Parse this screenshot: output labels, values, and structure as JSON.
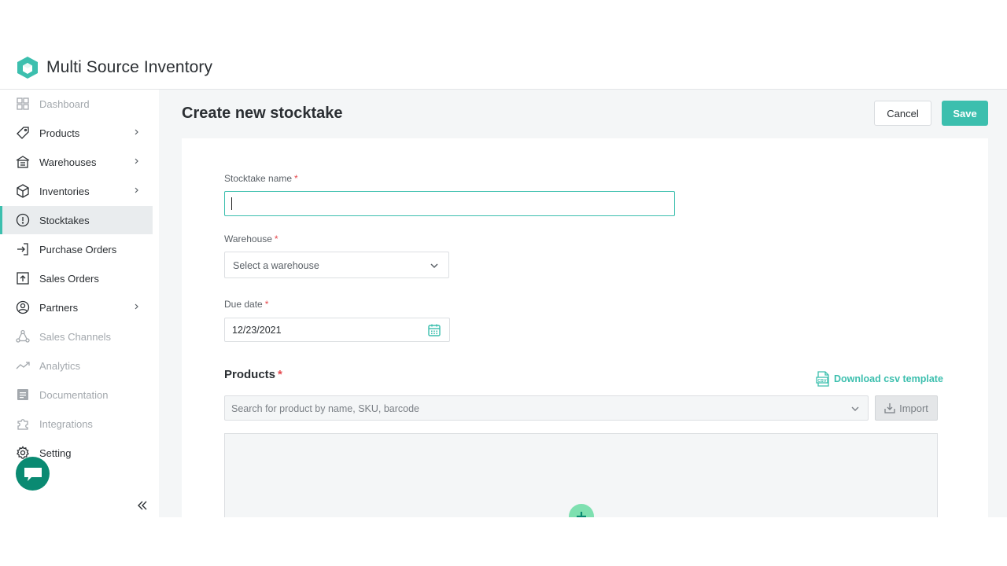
{
  "app": {
    "title": "Multi Source Inventory",
    "logo_icon": "cube-logo-icon",
    "brand_color": "#3cbfae"
  },
  "sidebar": {
    "items": [
      {
        "label": "Dashboard",
        "icon": "grid-icon",
        "disabled": true,
        "chevron": false
      },
      {
        "label": "Products",
        "icon": "tag-icon",
        "disabled": false,
        "chevron": true
      },
      {
        "label": "Warehouses",
        "icon": "warehouse-icon",
        "disabled": false,
        "chevron": true
      },
      {
        "label": "Inventories",
        "icon": "box-icon",
        "disabled": false,
        "chevron": true
      },
      {
        "label": "Stocktakes",
        "icon": "clock-icon",
        "disabled": false,
        "chevron": false,
        "active": true
      },
      {
        "label": "Purchase Orders",
        "icon": "login-arrow-icon",
        "disabled": false,
        "chevron": false
      },
      {
        "label": "Sales Orders",
        "icon": "upload-box-icon",
        "disabled": false,
        "chevron": false
      },
      {
        "label": "Partners",
        "icon": "user-circle-icon",
        "disabled": false,
        "chevron": true
      },
      {
        "label": "Sales Channels",
        "icon": "network-icon",
        "disabled": true,
        "chevron": false
      },
      {
        "label": "Analytics",
        "icon": "trend-icon",
        "disabled": true,
        "chevron": false
      },
      {
        "label": "Documentation",
        "icon": "document-icon",
        "disabled": true,
        "chevron": false
      },
      {
        "label": "Integrations",
        "icon": "puzzle-icon",
        "disabled": true,
        "chevron": false
      },
      {
        "label": "Setting",
        "icon": "gear-icon",
        "disabled": false,
        "chevron": false
      }
    ],
    "collapse_icon": "double-chevron-left-icon"
  },
  "page": {
    "title": "Create new stocktake",
    "cancel_label": "Cancel",
    "save_label": "Save"
  },
  "form": {
    "name_label": "Stocktake name",
    "name_value": "",
    "warehouse_label": "Warehouse",
    "warehouse_placeholder": "Select a warehouse",
    "due_label": "Due date",
    "due_value": "12/23/2021",
    "required_mark": "*"
  },
  "products": {
    "label": "Products",
    "download_label": "Download csv template",
    "search_placeholder": "Search for product by name, SKU, barcode",
    "import_label": "Import"
  },
  "chat": {
    "icon": "chat-bubble-icon"
  }
}
